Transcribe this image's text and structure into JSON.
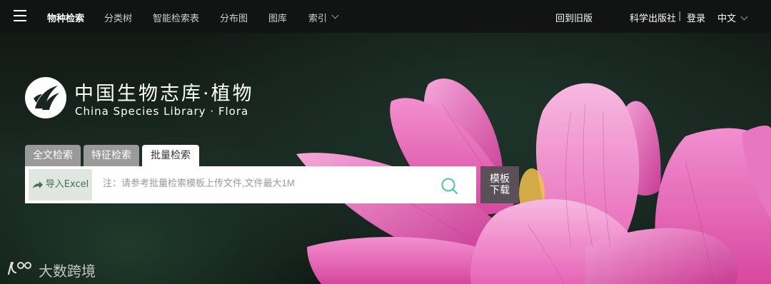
{
  "nav": {
    "items": [
      {
        "label": "物种检索",
        "active": true
      },
      {
        "label": "分类树"
      },
      {
        "label": "智能检索表"
      },
      {
        "label": "分布图"
      },
      {
        "label": "图库"
      },
      {
        "label": "索引"
      }
    ],
    "back_to_old": "回到旧版",
    "publisher": "科学出版社",
    "separator": "|",
    "login": "登录",
    "language": "中文"
  },
  "logo": {
    "title_cn": "中国生物志库·植物",
    "title_en": "China Species Library · Flora"
  },
  "tabs": [
    {
      "label": "全文检索",
      "active": false
    },
    {
      "label": "特征检索",
      "active": false
    },
    {
      "label": "批量检索",
      "active": true
    }
  ],
  "search": {
    "import_label": "导入Excel",
    "placeholder": "注：请参考批量检索模板上传文件,文件最大1M",
    "template_line1": "模板",
    "template_line2": "下载"
  },
  "watermark": {
    "text": "大数跨境"
  },
  "colors": {
    "accent": "#4fc1a4",
    "template_button": "#5b4f58",
    "lotus": "#e25fb5"
  }
}
